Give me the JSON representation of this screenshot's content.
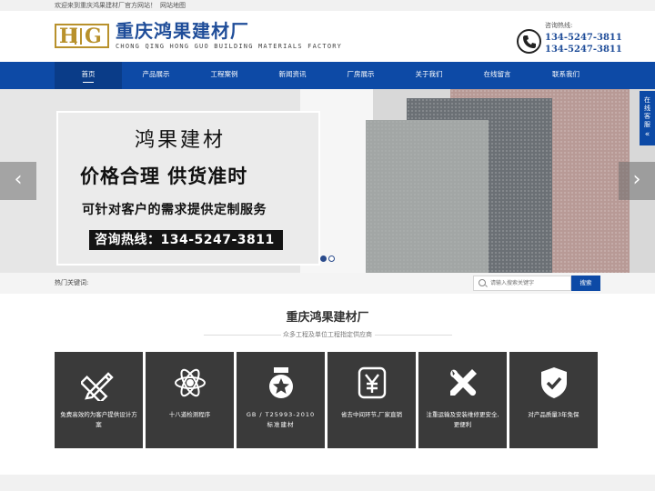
{
  "topbar": {
    "welcome": "欢迎来到重庆鸿果建材厂官方网站！",
    "sitemap": "网站地图"
  },
  "header": {
    "logo_mark": "HG",
    "company_name": "重庆鸿果建材厂",
    "company_en": "CHONG QING HONG GUO BUILDING MATERIALS FACTORY",
    "contact_label": "咨询热线:",
    "phone_1": "134-5247-3811",
    "phone_2": "134-5247-3811"
  },
  "nav": {
    "items": [
      {
        "label": "首页"
      },
      {
        "label": "产品展示"
      },
      {
        "label": "工程案例"
      },
      {
        "label": "新闻资讯"
      },
      {
        "label": "厂房展示"
      },
      {
        "label": "关于我们"
      },
      {
        "label": "在线留言"
      },
      {
        "label": "联系我们"
      }
    ],
    "active_index": 0
  },
  "banner": {
    "line1": "鸿果建材",
    "line2": "价格合理  供货准时",
    "line3": "可针对客户的需求提供定制服务",
    "hotline": "咨询热线：134-5247-3811",
    "prev_glyph": "‹",
    "next_glyph": "›",
    "slide_count": 2,
    "active_slide": 0
  },
  "side_tab": {
    "label": "在线客服",
    "chevron": "«"
  },
  "keywords": {
    "label": "热门关键词:",
    "search_placeholder": "请输入搜索关键字",
    "search_button": "搜索"
  },
  "section": {
    "title": "重庆鸿果建材厂",
    "subtitle": "众多工程及单位工程指定供应商"
  },
  "features": [
    {
      "icon": "pencil-ruler-icon",
      "caption": "免费高效的为客户提供设计方案"
    },
    {
      "icon": "atom-icon",
      "caption": "十八道检测程序"
    },
    {
      "icon": "medal-icon",
      "caption": "GB / T25993-2010 标准建材"
    },
    {
      "icon": "yen-icon",
      "caption": "省去中间环节,厂家直销"
    },
    {
      "icon": "tools-icon",
      "caption": "注重运输及安装维修更安全,更便利"
    },
    {
      "icon": "shield-check-icon",
      "caption": "对产品质量3年免保"
    }
  ],
  "colors": {
    "brand_blue": "#0d4aa6",
    "logo_gold": "#b8912c",
    "card_bg": "#3a3a3a"
  }
}
